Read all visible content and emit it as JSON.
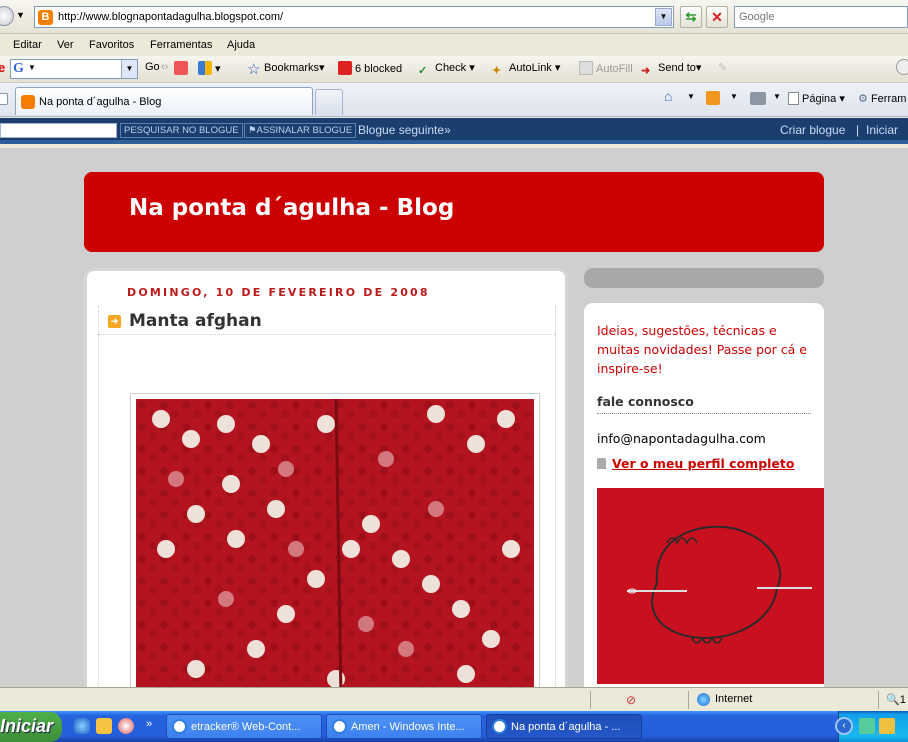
{
  "browser": {
    "url": "http://www.blognapontadagulha.blogspot.com/",
    "search_placeholder": "Google",
    "menu": [
      "Editar",
      "Ver",
      "Favoritos",
      "Ferramentas",
      "Ajuda"
    ],
    "google_toolbar": {
      "go_label": "Go",
      "bookmarks_label": "Bookmarks▾",
      "blocked_label": "6 blocked",
      "check_label": "Check",
      "autolink_label": "AutoLink",
      "autofill_label": "AutoFill",
      "sendto_label": "Send to▾"
    },
    "tab_title": "Na ponta d´agulha - Blog",
    "command_bar": {
      "page_label": "Página",
      "tools_label": "Ferram"
    },
    "status": {
      "zone": "Internet",
      "zoom": "1"
    }
  },
  "navbar": {
    "search_button": "PESQUISAR NO BLOGUE",
    "flag_button": "ASSINALAR BLOGUE",
    "next_blog": "Blogue seguinte»",
    "create_blog": "Criar blogue",
    "separator": "|",
    "sign_in": "Iniciar"
  },
  "blog": {
    "title": "Na ponta d´agulha - Blog",
    "post": {
      "date": "DOMINGO, 10 DE FEVEREIRO DE 2008",
      "title": "Manta afghan"
    },
    "sidebar": {
      "description": "Ideias, sugestões, técnicas e muitas novidades! Passe por cá e inspire-se!",
      "contact_heading": "fale connosco",
      "email": "info@napontadagulha.com",
      "profile_link": "Ver o meu perfil completo"
    }
  },
  "taskbar": {
    "start_label": "Iniciar",
    "tasks": [
      {
        "label": "etracker® Web-Cont...",
        "active": false
      },
      {
        "label": "Amen - Windows Inte...",
        "active": false
      },
      {
        "label": "Na ponta d´agulha - ...",
        "active": true
      }
    ]
  },
  "colors": {
    "blog_red": "#cc0000",
    "navbar_blue": "#1c3e6e",
    "page_gray": "#cfcfcf"
  }
}
